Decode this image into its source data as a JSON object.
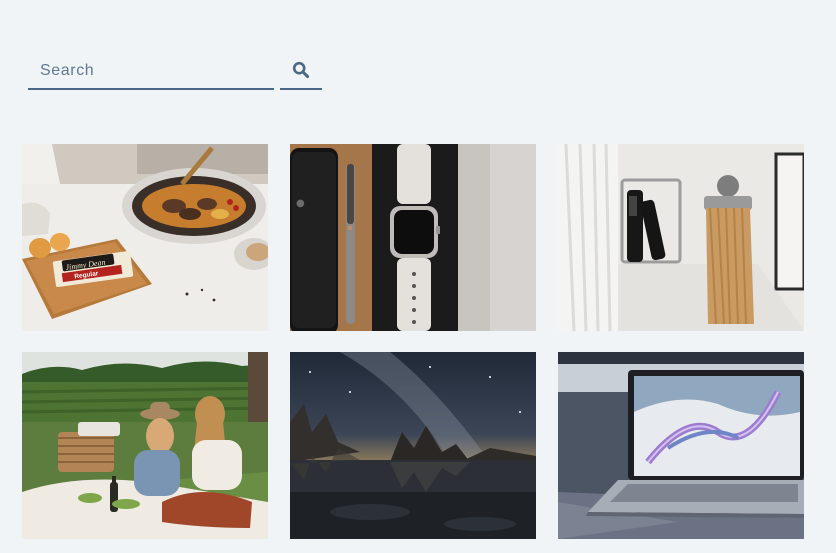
{
  "search": {
    "placeholder": "Search",
    "value": "",
    "button_icon": "search-icon"
  },
  "colors": {
    "background": "#f1f4f7",
    "accent": "#4a6785"
  },
  "gallery": {
    "photos": [
      {
        "subject": "breakfast skillet with sausage package",
        "label_line1": "Jimmy Dean",
        "label_line2": "Regular"
      },
      {
        "subject": "smartphone, pen and smartwatch flat lay"
      },
      {
        "subject": "hair extensions and hair care bottles on wall"
      },
      {
        "subject": "two women having a picnic in a field"
      },
      {
        "subject": "milky way over mountains reflected in lake"
      },
      {
        "subject": "laptop with abstract colorful wallpaper"
      }
    ]
  }
}
